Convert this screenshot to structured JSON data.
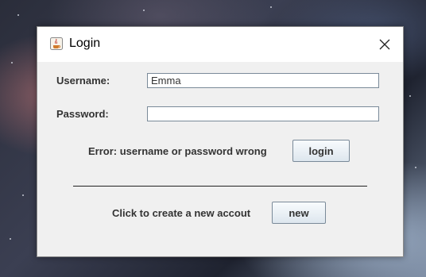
{
  "window": {
    "title": "Login",
    "app_icon": "java-icon",
    "close_icon": "close-icon"
  },
  "form": {
    "username_label": "Username:",
    "username_value": "Emma",
    "password_label": "Password:",
    "password_value": "",
    "error_message": "Error: username or password wrong",
    "login_button": "login",
    "create_prompt": "Click to create a new accout",
    "new_button": "new"
  },
  "colors": {
    "dialog_background": "#f0f0f0",
    "titlebar_background": "#ffffff",
    "button_border": "#7a8a99"
  }
}
